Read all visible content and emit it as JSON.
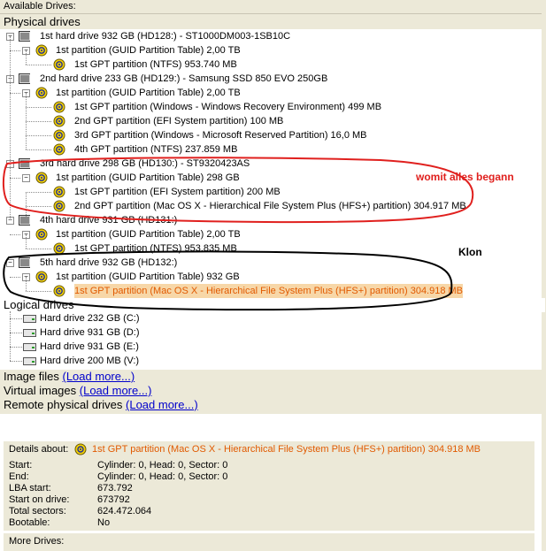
{
  "header": {
    "title": "Available Drives:"
  },
  "sections": {
    "physical": "Physical drives",
    "logical": "Logical drives"
  },
  "physical_tree": [
    {
      "label": "1st hard drive 932 GB (HD128:) - ST1000DM003-1SB10C",
      "kind": "disk",
      "level": 0
    },
    {
      "label": "1st partition (GUID Partition Table) 2,00 TB",
      "kind": "part",
      "level": 1
    },
    {
      "label": "1st GPT partition (NTFS) 953.740 MB",
      "kind": "part",
      "level": 2
    },
    {
      "label": "2nd hard drive 233 GB (HD129:) - Samsung SSD 850 EVO 250GB",
      "kind": "disk",
      "level": 0
    },
    {
      "label": "1st partition (GUID Partition Table) 2,00 TB",
      "kind": "part",
      "level": 1
    },
    {
      "label": "1st GPT partition (Windows - Windows Recovery Environment) 499 MB",
      "kind": "part",
      "level": 2
    },
    {
      "label": "2nd GPT partition (EFI System partition) 100 MB",
      "kind": "part",
      "level": 2
    },
    {
      "label": "3rd GPT partition (Windows - Microsoft Reserved Partition) 16,0 MB",
      "kind": "part",
      "level": 2
    },
    {
      "label": "4th GPT partition (NTFS) 237.859 MB",
      "kind": "part",
      "level": 2
    },
    {
      "label": "3rd hard drive 298 GB (HD130:) - ST9320423AS",
      "kind": "disk",
      "level": 0
    },
    {
      "label": "1st partition (GUID Partition Table) 298 GB",
      "kind": "part",
      "level": 1
    },
    {
      "label": "1st GPT partition (EFI System partition) 200 MB",
      "kind": "part",
      "level": 2
    },
    {
      "label": "2nd GPT partition (Mac OS X - Hierarchical File System Plus (HFS+) partition) 304.917 MB",
      "kind": "part",
      "level": 2
    },
    {
      "label": "4th hard drive 931 GB (HD131:)",
      "kind": "disk",
      "level": 0
    },
    {
      "label": "1st partition (GUID Partition Table) 2,00 TB",
      "kind": "part",
      "level": 1
    },
    {
      "label": "1st GPT partition (NTFS) 953.835 MB",
      "kind": "part",
      "level": 2
    },
    {
      "label": "5th hard drive 932 GB (HD132:)",
      "kind": "disk",
      "level": 0
    },
    {
      "label": "1st partition (GUID Partition Table) 932 GB",
      "kind": "part",
      "level": 1
    },
    {
      "label": "1st GPT partition (Mac OS X - Hierarchical File System Plus (HFS+) partition) 304.918 MB",
      "kind": "part",
      "level": 2,
      "selected": true
    }
  ],
  "logical_drives": [
    "Hard drive 232 GB (C:)",
    "Hard drive 931 GB (D:)",
    "Hard drive 931 GB (E:)",
    "Hard drive 200 MB (V:)"
  ],
  "extra_sections": [
    {
      "label": "Image files",
      "link": "(Load more...)"
    },
    {
      "label": "Virtual images",
      "link": "(Load more...)"
    },
    {
      "label": "Remote physical drives",
      "link": "(Load more...)"
    }
  ],
  "annotations": {
    "red_note": "womit alles begann",
    "black_note": "Klon",
    "red_color": "#e0201e",
    "black_color": "#000000"
  },
  "details": {
    "title": "Details about:",
    "selected_item": "1st GPT partition (Mac OS X - Hierarchical File System Plus (HFS+) partition) 304.918 MB",
    "fields": [
      {
        "label": "Start:",
        "value": "Cylinder: 0, Head: 0, Sector: 0"
      },
      {
        "label": "End:",
        "value": "Cylinder: 0, Head: 0, Sector: 0"
      },
      {
        "label": "LBA start:",
        "value": "673.792"
      },
      {
        "label": "Start on drive:",
        "value": "673792"
      },
      {
        "label": "Total sectors:",
        "value": "624.472.064"
      },
      {
        "label": "Bootable:",
        "value": "No"
      }
    ]
  },
  "footer": {
    "more_drives": "More Drives:"
  },
  "icons": {
    "disk": "hard-drive-icon",
    "partition": "partition-icon",
    "logical": "logical-drive-icon"
  }
}
